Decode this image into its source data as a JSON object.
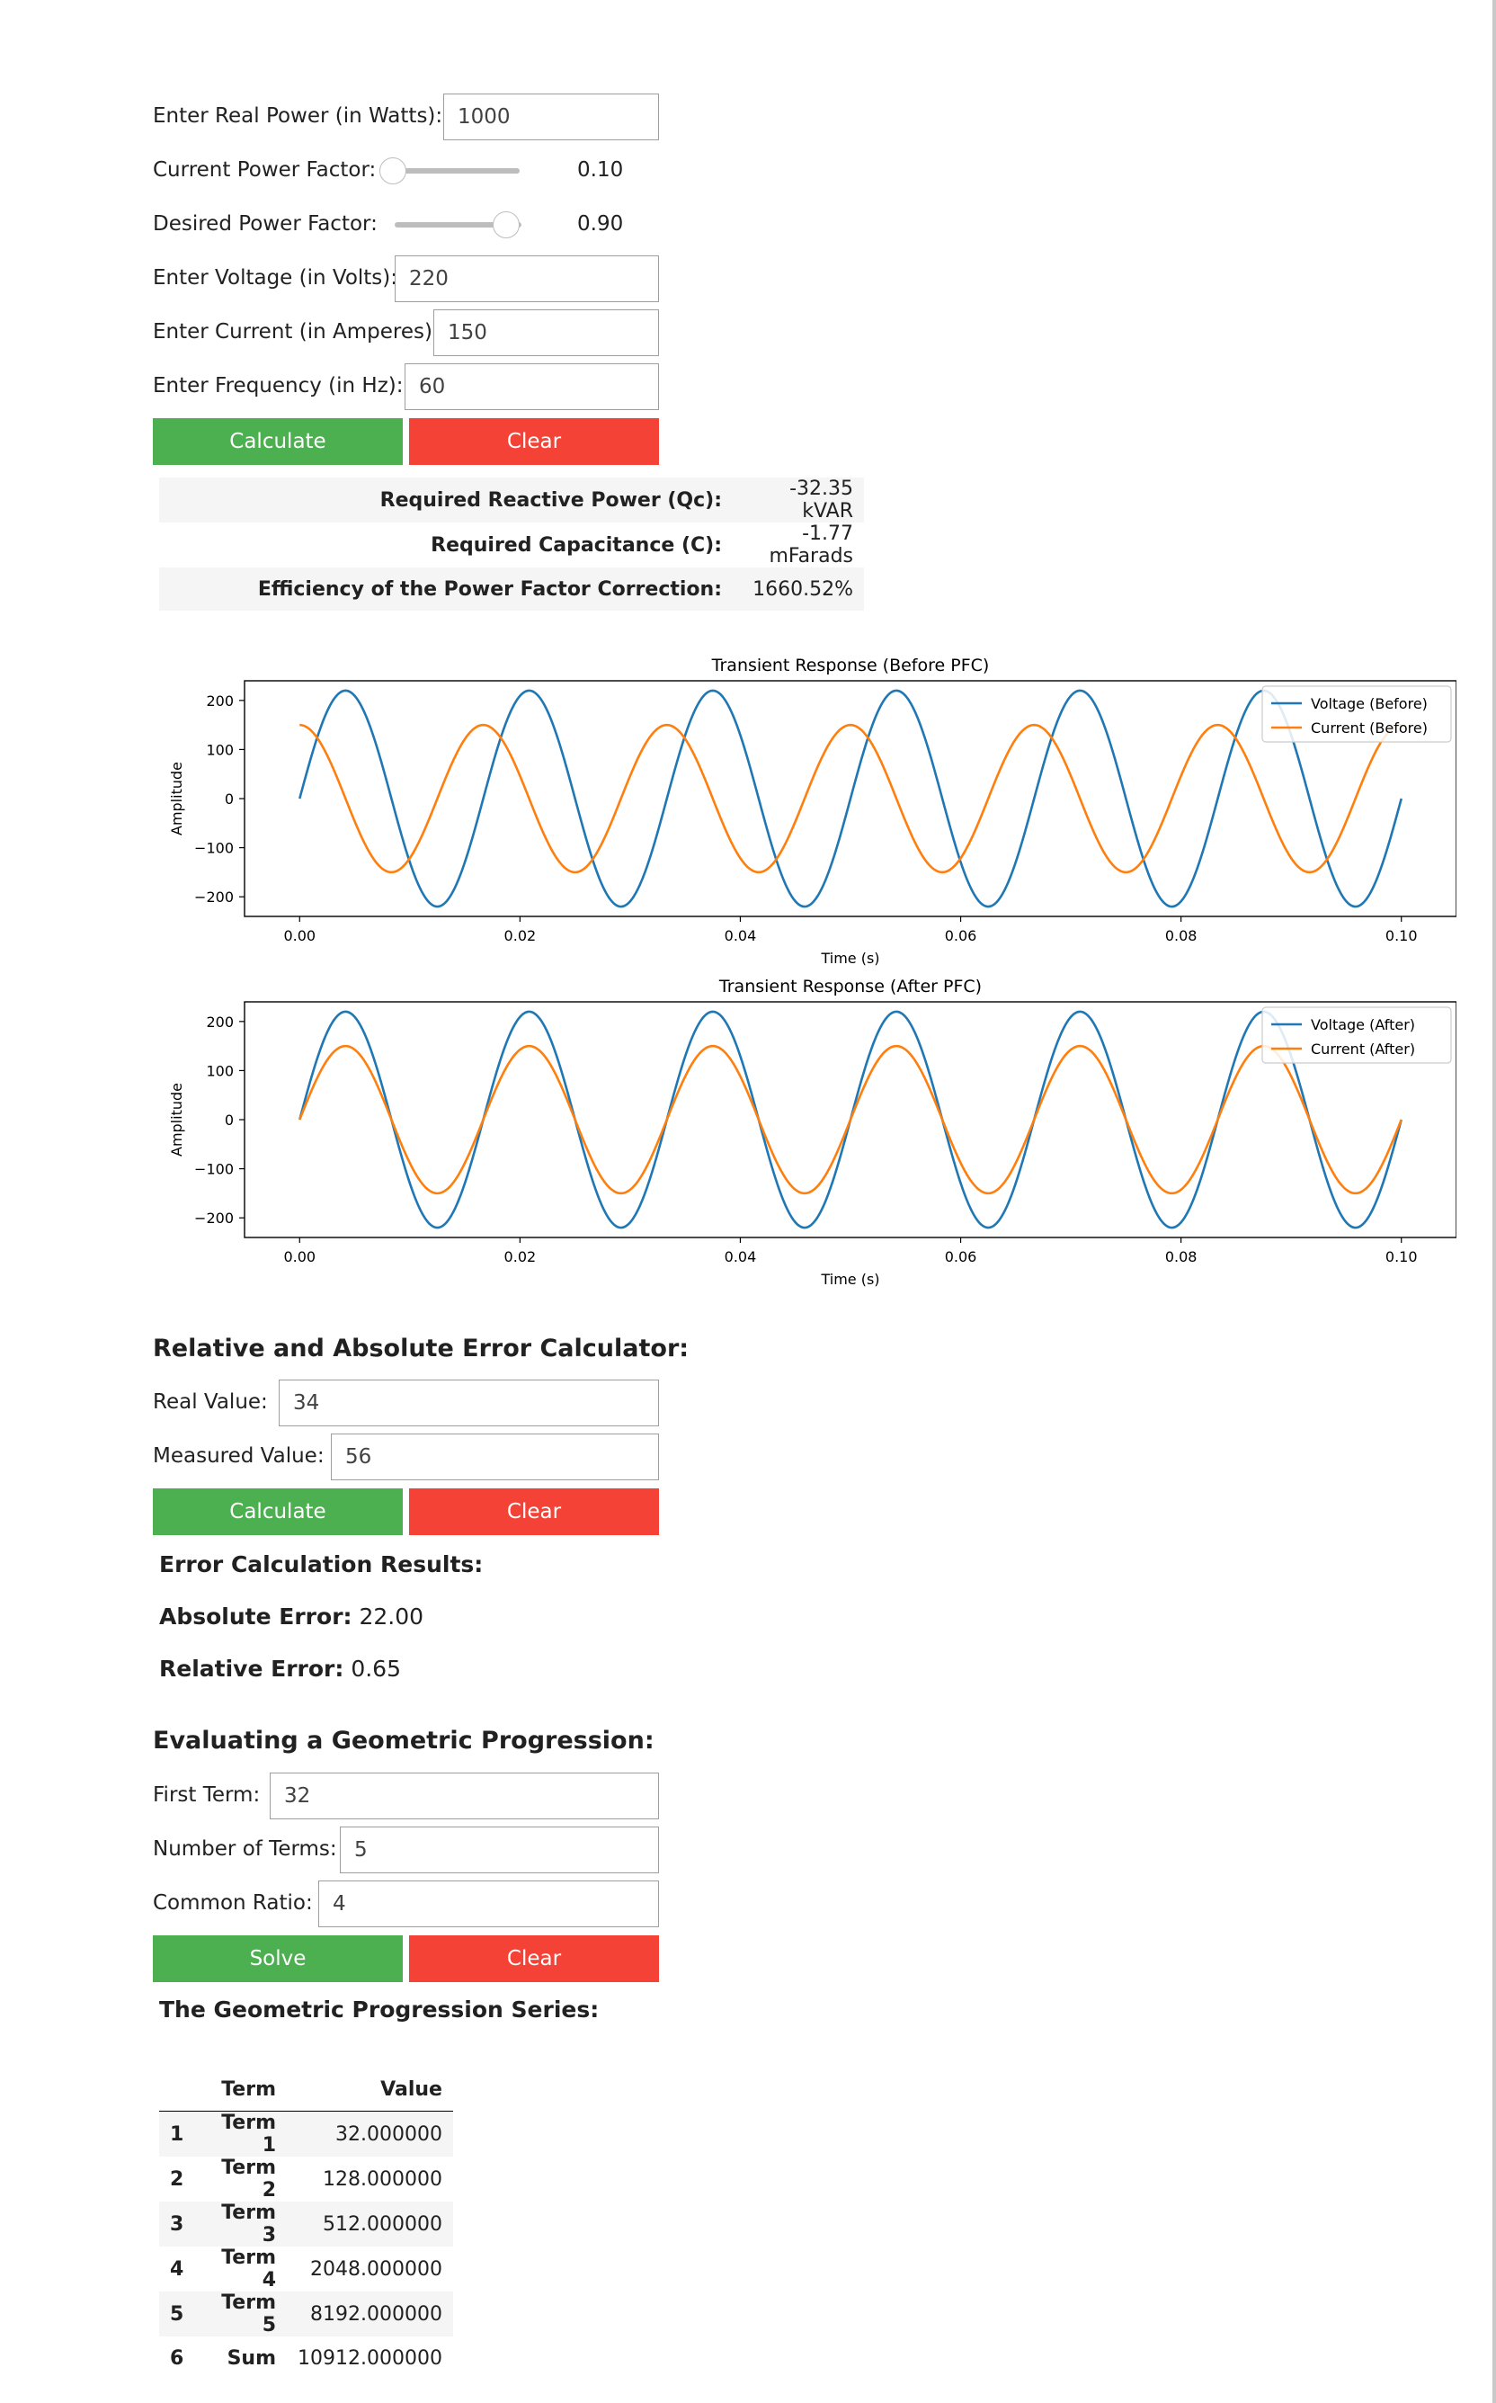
{
  "pfc": {
    "real_power_label": "Enter Real Power (in Watts):",
    "real_power_value": "1000",
    "current_pf_label": "Current Power Factor:",
    "current_pf_value": 0.1,
    "current_pf_text": "0.10",
    "desired_pf_label": "Desired Power Factor:",
    "desired_pf_value": 0.9,
    "desired_pf_text": "0.90",
    "voltage_label": "Enter Voltage (in Volts):",
    "voltage_value": "220",
    "current_label": "Enter Current (in Amperes):",
    "current_value": "150",
    "frequency_label": "Enter Frequency (in Hz):",
    "frequency_value": "60",
    "calculate_label": "Calculate",
    "clear_label": "Clear",
    "results": [
      {
        "key": "Required Reactive Power (Qc):",
        "value": "-32.35 kVAR"
      },
      {
        "key": "Required Capacitance (C):",
        "value": "-1.77 mFarads"
      },
      {
        "key": "Efficiency of the Power Factor Correction:",
        "value": "1660.52%"
      }
    ]
  },
  "chart_data": [
    {
      "type": "line",
      "title": "Transient Response (Before PFC)",
      "xlabel": "Time (s)",
      "ylabel": "Amplitude",
      "xlim": [
        -0.005,
        0.105
      ],
      "ylim": [
        -240,
        240
      ],
      "xticks": [
        "0.00",
        "0.02",
        "0.04",
        "0.06",
        "0.08",
        "0.10"
      ],
      "yticks": [
        "200",
        "100",
        "0",
        "−100",
        "−200"
      ],
      "legend_position": "top-right",
      "frequency_hz": 60,
      "x_range": [
        0,
        0.1
      ],
      "series": [
        {
          "name": "Voltage (Before)",
          "amplitude": 220,
          "phase_deg": 0,
          "color": "#1f77b4"
        },
        {
          "name": "Current (Before)",
          "amplitude": 150,
          "phase_deg": 90,
          "color": "#ff7f0e"
        }
      ]
    },
    {
      "type": "line",
      "title": "Transient Response (After PFC)",
      "xlabel": "Time (s)",
      "ylabel": "Amplitude",
      "xlim": [
        -0.005,
        0.105
      ],
      "ylim": [
        -240,
        240
      ],
      "xticks": [
        "0.00",
        "0.02",
        "0.04",
        "0.06",
        "0.08",
        "0.10"
      ],
      "yticks": [
        "200",
        "100",
        "0",
        "−100",
        "−200"
      ],
      "legend_position": "top-right",
      "frequency_hz": 60,
      "x_range": [
        0,
        0.1
      ],
      "series": [
        {
          "name": "Voltage (After)",
          "amplitude": 220,
          "phase_deg": 0,
          "color": "#1f77b4"
        },
        {
          "name": "Current (After)",
          "amplitude": 150,
          "phase_deg": 0,
          "color": "#ff7f0e"
        }
      ]
    }
  ],
  "error_calc": {
    "heading": "Relative and Absolute Error Calculator:",
    "real_label": "Real Value:",
    "real_value": "34",
    "measured_label": "Measured Value:",
    "measured_value": "56",
    "calculate_label": "Calculate",
    "clear_label": "Clear",
    "results_heading": "Error Calculation Results:",
    "abs_label": "Absolute Error:",
    "abs_value": "22.00",
    "rel_label": "Relative Error:",
    "rel_value": "0.65"
  },
  "geo": {
    "heading": "Evaluating a Geometric Progression:",
    "first_label": "First Term:",
    "first_value": "32",
    "num_label": "Number of Terms:",
    "num_value": "5",
    "ratio_label": "Common Ratio:",
    "ratio_value": "4",
    "solve_label": "Solve",
    "clear_label": "Clear",
    "series_heading": "The Geometric Progression Series:",
    "col_term": "Term",
    "col_value": "Value",
    "rows": [
      {
        "idx": "1",
        "term": "Term 1",
        "value": "32.000000"
      },
      {
        "idx": "2",
        "term": "Term 2",
        "value": "128.000000"
      },
      {
        "idx": "3",
        "term": "Term 3",
        "value": "512.000000"
      },
      {
        "idx": "4",
        "term": "Term 4",
        "value": "2048.000000"
      },
      {
        "idx": "5",
        "term": "Term 5",
        "value": "8192.000000"
      },
      {
        "idx": "6",
        "term": "Sum",
        "value": "10912.000000"
      }
    ]
  },
  "colors": {
    "calculate_button": "#4caf50",
    "clear_button": "#f44336",
    "voltage_line": "#1f77b4",
    "current_line": "#ff7f0e"
  }
}
